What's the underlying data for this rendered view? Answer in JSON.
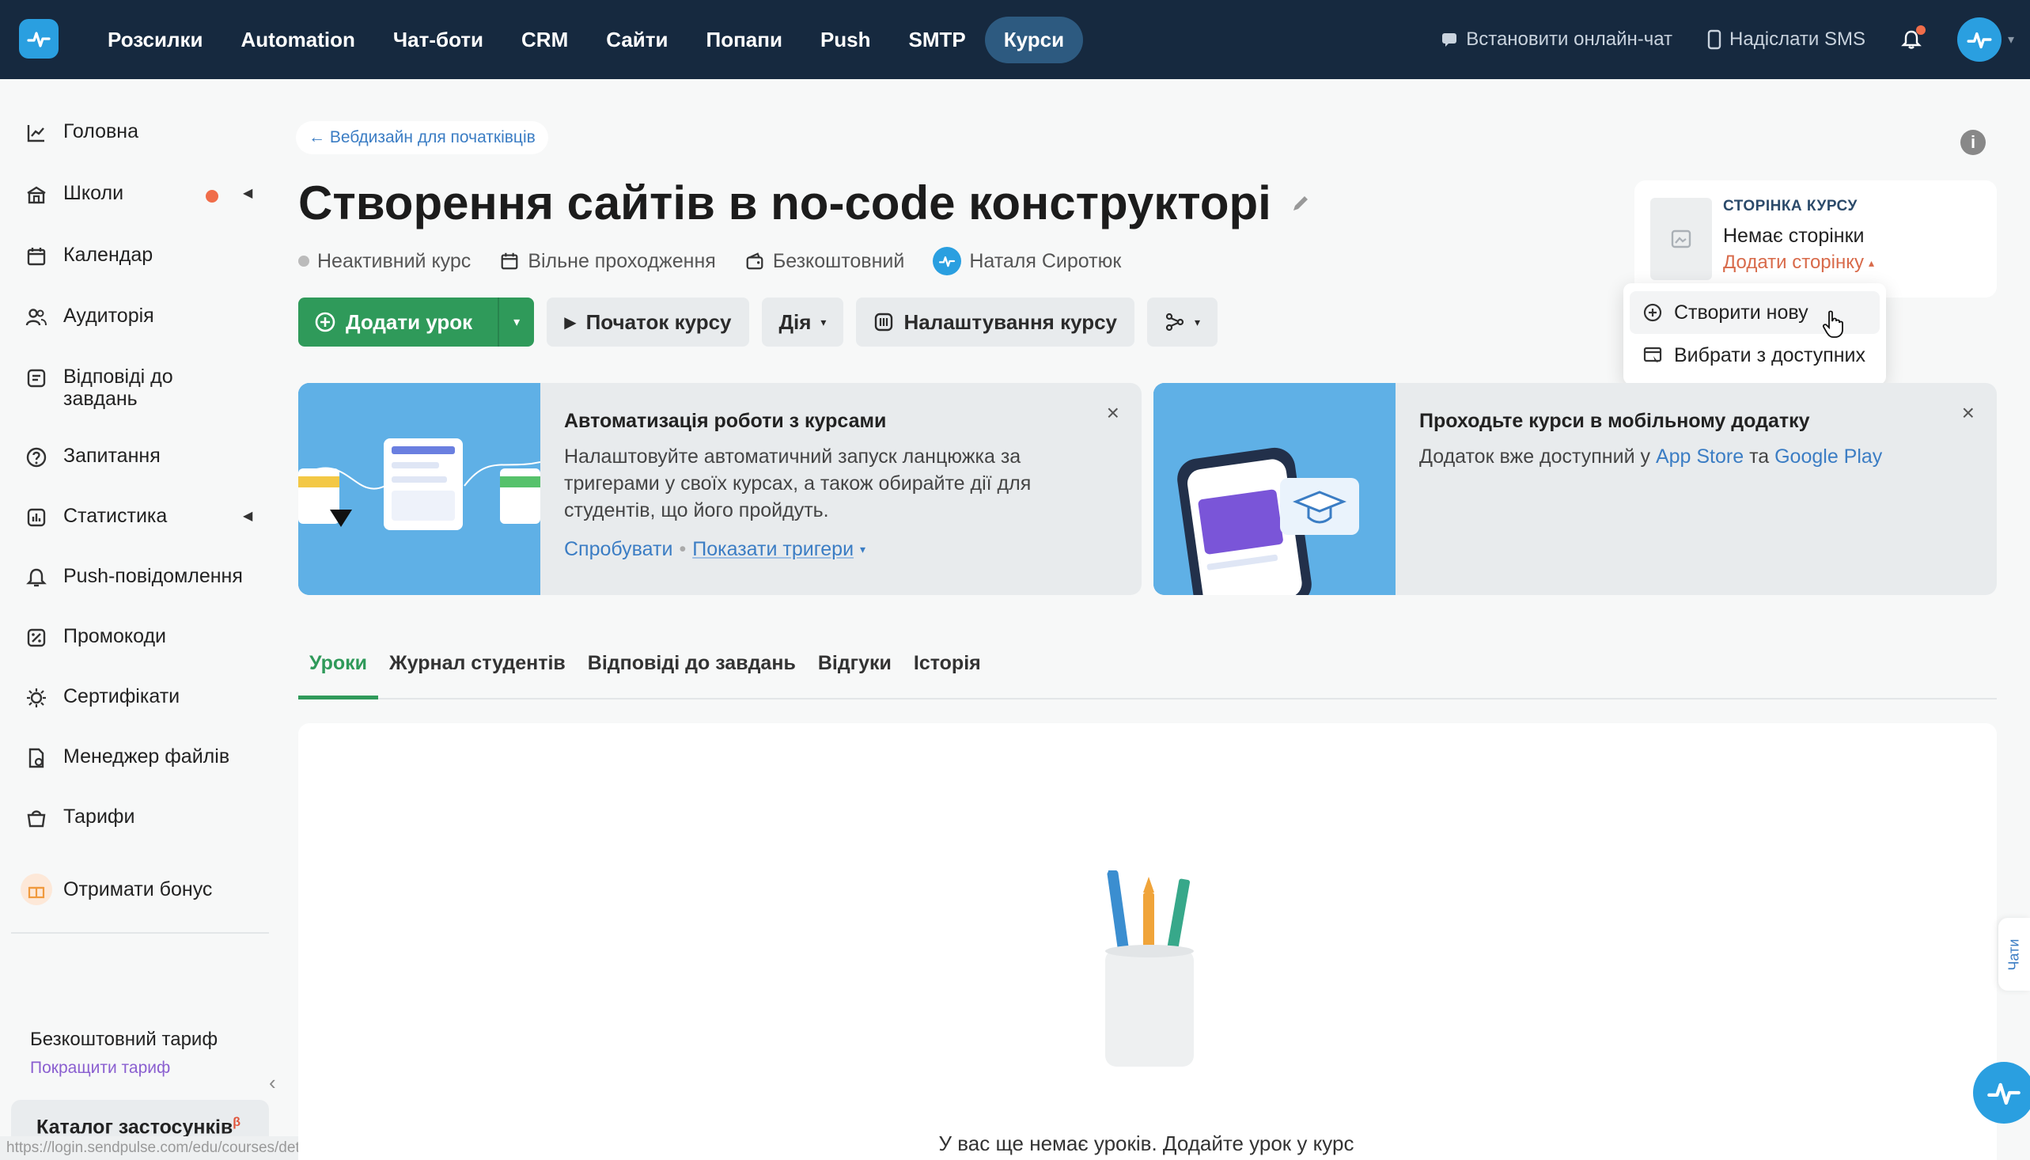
{
  "topnav": {
    "items": [
      "Розсилки",
      "Automation",
      "Чат-боти",
      "CRM",
      "Сайти",
      "Попапи",
      "Push",
      "SMTP",
      "Курси"
    ],
    "active_index": 8,
    "online_chat": "Встановити онлайн-чат",
    "sms": "Надіслати SMS"
  },
  "sidebar": {
    "items": [
      {
        "label": "Головна",
        "icon": "chart-line-icon"
      },
      {
        "label": "Школи",
        "icon": "school-icon"
      },
      {
        "label": "Календар",
        "icon": "calendar-icon"
      },
      {
        "label": "Аудиторія",
        "icon": "users-icon"
      },
      {
        "label": "Відповіді до завдань",
        "icon": "tasks-icon"
      },
      {
        "label": "Запитання",
        "icon": "question-icon"
      },
      {
        "label": "Статистика",
        "icon": "stats-icon"
      },
      {
        "label": "Push-повідомлення",
        "icon": "bell-icon"
      },
      {
        "label": "Промокоди",
        "icon": "promo-icon"
      },
      {
        "label": "Сертифікати",
        "icon": "certificate-icon"
      },
      {
        "label": "Менеджер файлів",
        "icon": "files-icon"
      },
      {
        "label": "Тарифи",
        "icon": "tariff-icon"
      }
    ],
    "bonus": "Отримати бонус",
    "plan_name": "Безкоштовний тариф",
    "upgrade": "Покращити тариф",
    "catalog": "Каталог застосунків",
    "catalog_badge": "β"
  },
  "status_url": "https://login.sendpulse.com/edu/courses/details/37861/create-page",
  "breadcrumb": "← Вебдизайн для початківців",
  "course": {
    "title": "Створення сайтів в no-code конструкторі",
    "status": "Неактивний курс",
    "mode": "Вільне проходження",
    "price": "Безкоштовний",
    "author": "Наталя Сиротюк"
  },
  "toolbar": {
    "add_lesson": "Додати урок",
    "start": "Початок курсу",
    "action": "Дія",
    "settings": "Налаштування курсу"
  },
  "course_page": {
    "label": "СТОРІНКА КУРСУ",
    "value": "Немає сторінки",
    "add": "Додати сторінку"
  },
  "dropdown": {
    "create": "Створити нову",
    "choose": "Вибрати з доступних"
  },
  "banner1": {
    "title": "Автоматизація роботи з курсами",
    "text": "Налаштовуйте автоматичний запуск ланцюжка за тригерами у своїх курсах, а також обирайте дії для студентів, що його пройдуть.",
    "try": "Спробувати",
    "sep": "•",
    "show": "Показати тригери"
  },
  "banner2": {
    "title": "Проходьте курси в мобільному додатку",
    "text_prefix": "Додаток вже доступний у",
    "app_store": "App Store",
    "and": "та",
    "google_play": "Google Play"
  },
  "tabs": [
    "Уроки",
    "Журнал студентів",
    "Відповіді до завдань",
    "Відгуки",
    "Історія"
  ],
  "empty": "У вас ще немає уроків. Додайте урок у курс",
  "chat_tab": "Чати",
  "colors": {
    "topbar": "#16293f",
    "primary": "#2f9a5a",
    "link": "#3b7dc4",
    "accent": "#f06d4a"
  }
}
